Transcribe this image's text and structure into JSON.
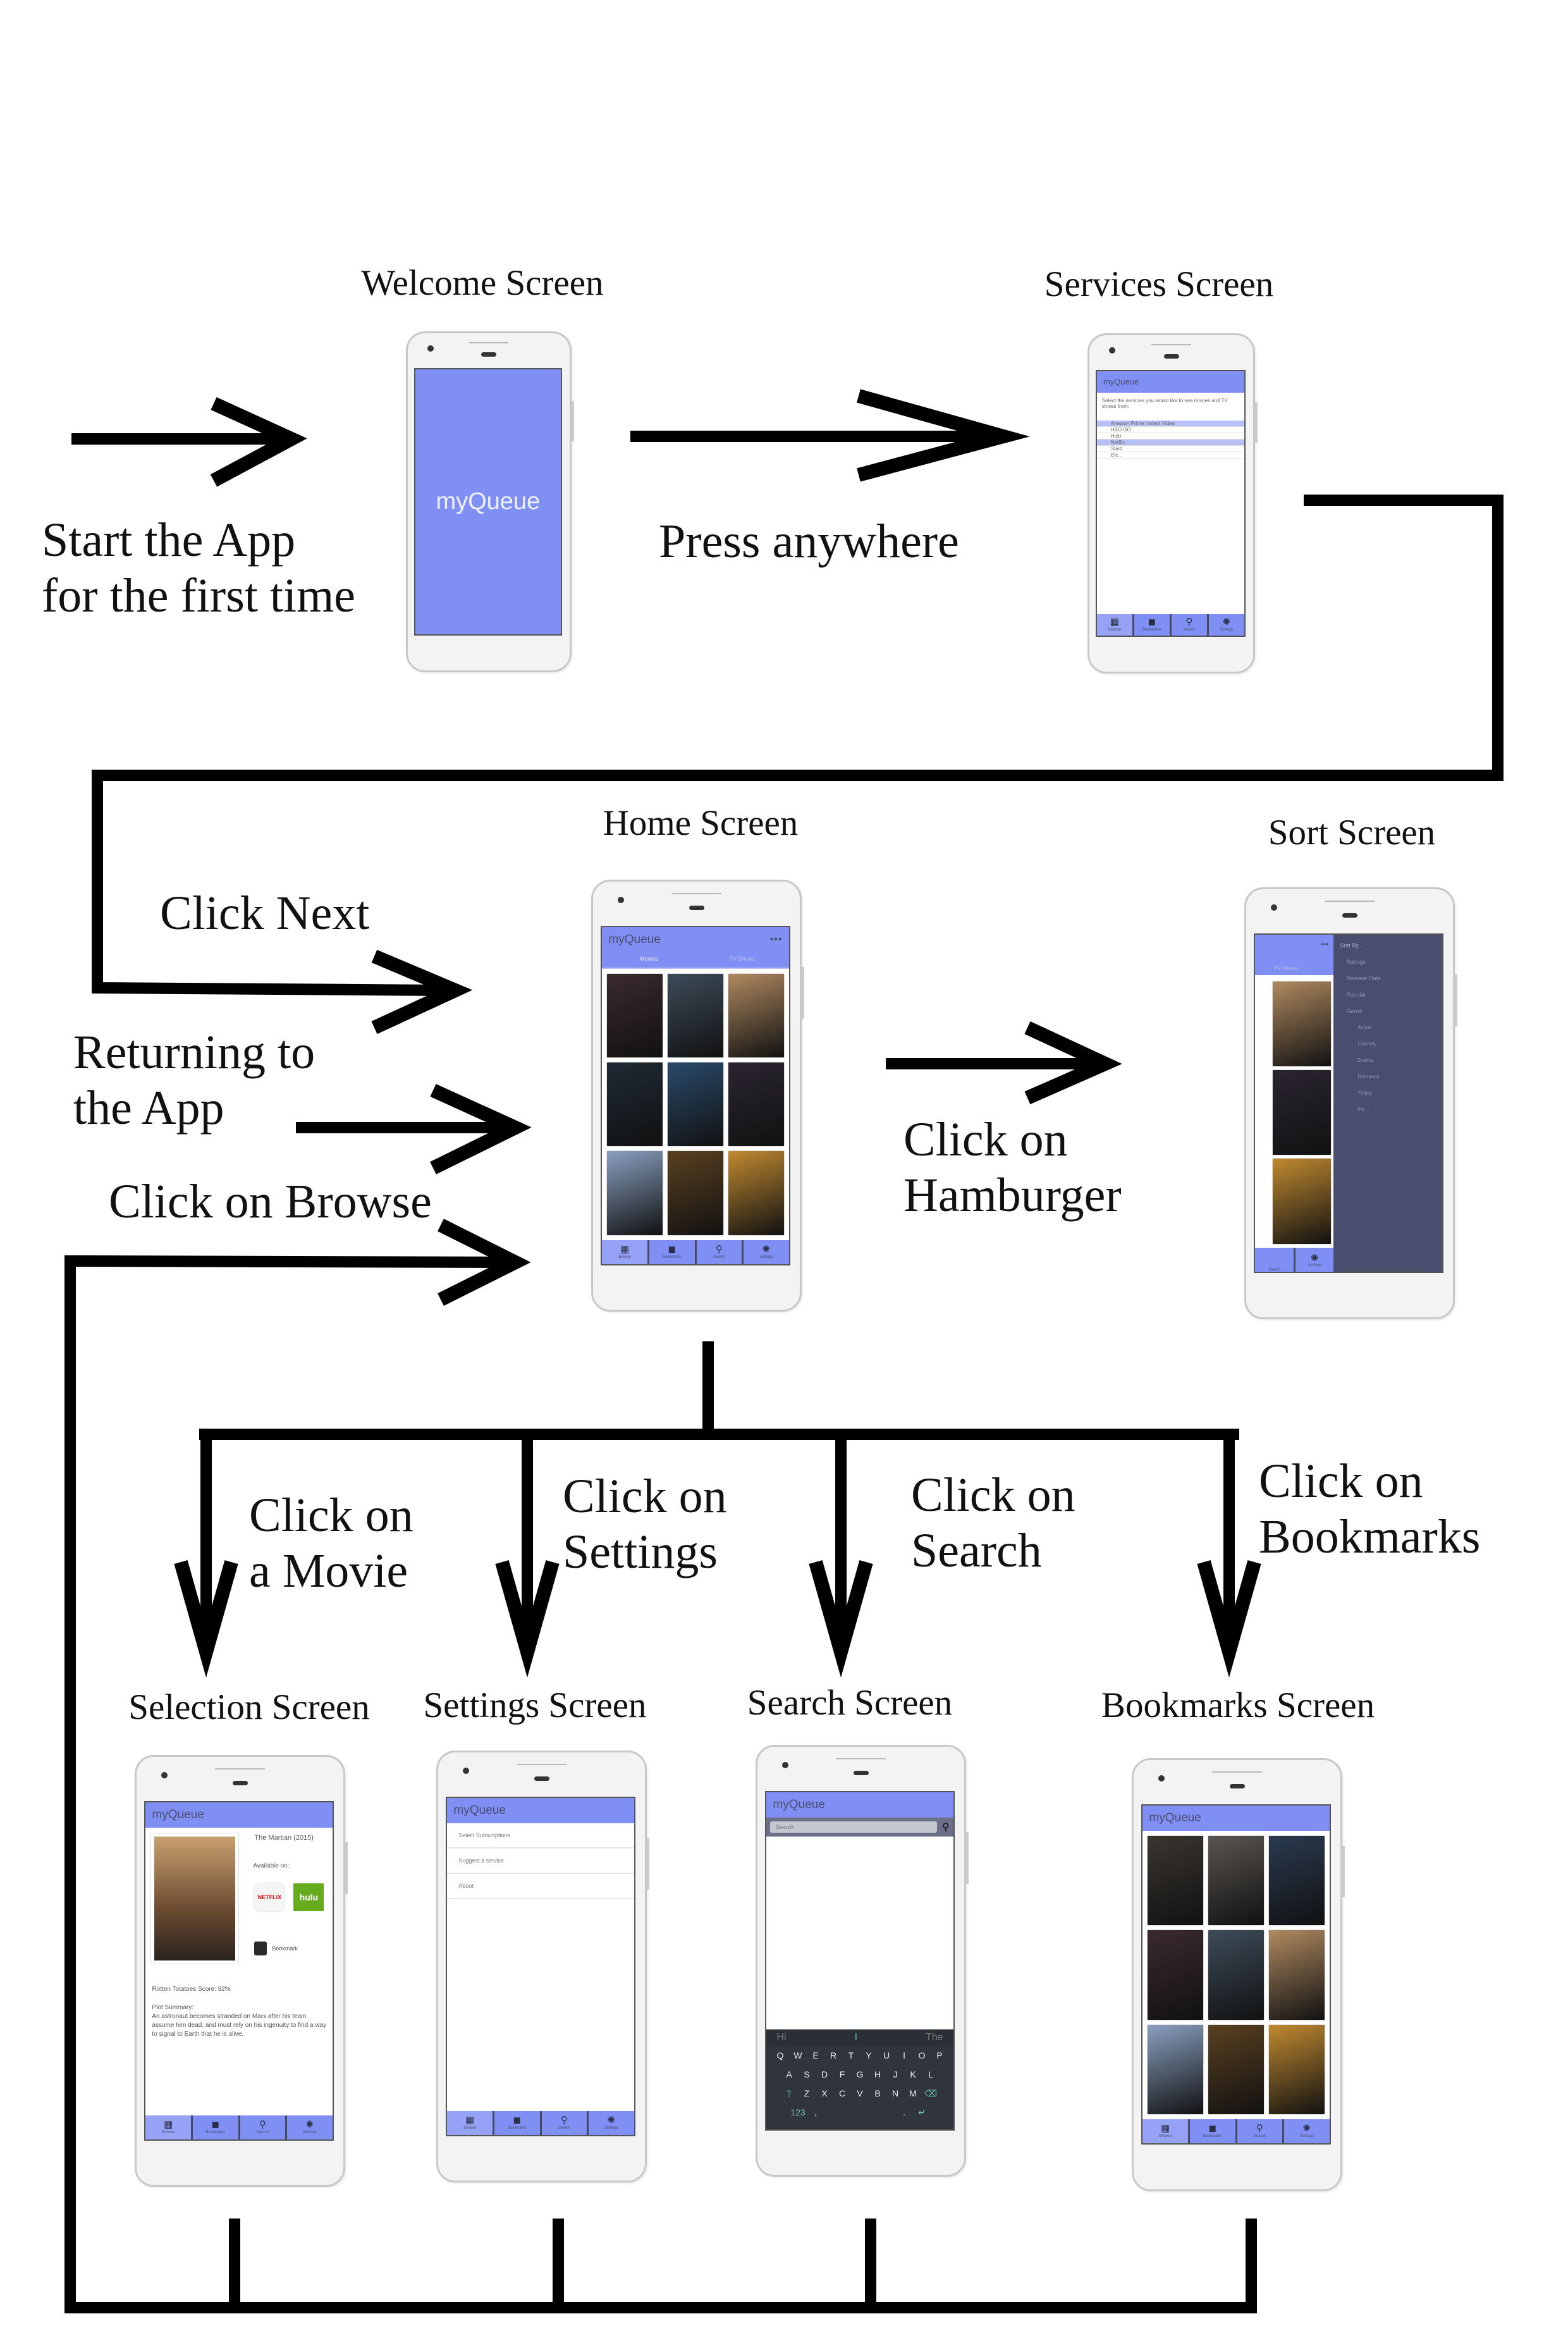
{
  "labels": {
    "start": [
      "Start the App",
      "for the first time"
    ],
    "press_anywhere": "Press anywhere",
    "click_next": "Click Next",
    "returning": [
      "Returning to",
      "the App"
    ],
    "click_browse": "Click on Browse",
    "click_hamburger": [
      "Click on",
      "Hamburger"
    ],
    "click_movie": [
      "Click on",
      "a Movie"
    ],
    "click_settings": [
      "Click on",
      "Settings"
    ],
    "click_search": [
      "Click on",
      "Search"
    ],
    "click_bookmarks": [
      "Click on",
      "Bookmarks"
    ]
  },
  "screen_titles": {
    "welcome": "Welcome Screen",
    "services": "Services Screen",
    "home": "Home Screen",
    "sort": "Sort Screen",
    "selection": "Selection Screen",
    "settings": "Settings Screen",
    "search": "Search Screen",
    "bookmarks": "Bookmarks Screen"
  },
  "app": {
    "name": "myQueue",
    "menu_dots": "•••",
    "accent": "#7f8ff4",
    "dark": "#4a4e6e",
    "highlight": "#b7c0f7"
  },
  "nav": [
    {
      "label": "Browse",
      "icon": "grid-icon",
      "glyph": "▦"
    },
    {
      "label": "Bookmarks",
      "icon": "bookmark-icon",
      "glyph": "◼"
    },
    {
      "label": "Search",
      "icon": "search-icon",
      "glyph": "⚲"
    },
    {
      "label": "Settings",
      "icon": "settings-icon",
      "glyph": "✺"
    }
  ],
  "services": {
    "prompt": "Select the services you would like to see movies and TV shows from:",
    "items": [
      {
        "label": "Amazon Prime Instant Video",
        "selected": true
      },
      {
        "label": "HBO GO",
        "selected": false
      },
      {
        "label": "Hulu",
        "selected": false
      },
      {
        "label": "Netflix",
        "selected": true
      },
      {
        "label": "Starz",
        "selected": false
      },
      {
        "label": "Etc...",
        "selected": false
      }
    ]
  },
  "home": {
    "tabs": [
      "Movies",
      "TV Shows"
    ],
    "poster_colors": [
      "#3a2a30",
      "#3d4c5a",
      "#b08a60",
      "#1e2a35",
      "#2a4a6a",
      "#2b2530",
      "#8aa0c0",
      "#5a4020",
      "#c08a30"
    ]
  },
  "sort": {
    "tab": "TV Shows",
    "heading": "Sort By...",
    "options": [
      "Ratings",
      "Release Date",
      "Popular",
      "Genre"
    ],
    "genres": [
      "Action",
      "Comedy",
      "Drama",
      "Romance",
      "Thiller",
      "Etc..."
    ],
    "poster_colors": [
      "#b08a60",
      "#2b2530",
      "#c08a30"
    ]
  },
  "selection": {
    "title": "The Martian (2015)",
    "available_on": "Available on:",
    "services": [
      {
        "label": "NETFLIX",
        "bg": "#f5f5f5",
        "fg": "#e50914"
      },
      {
        "label": "hulu",
        "bg": "#66aa1e",
        "fg": "#ffffff"
      }
    ],
    "bookmark": "Bookmark",
    "score": "Rotten Totatoes Score: 92%",
    "plot_heading": "Plot Summary:",
    "plot": "An astronaut becomes stranded on Mars after his team assume him dead, and must rely on his ingenuity to find a way to signal to Earth that he is alive.",
    "poster_color": "#a07a55"
  },
  "settings": {
    "items": [
      "Select Subscriptions",
      "Suggest a service",
      "About"
    ]
  },
  "search": {
    "placeholder": "Search",
    "suggestions": [
      "Hi",
      "I",
      "The"
    ],
    "rows": [
      [
        "Q",
        "W",
        "E",
        "R",
        "T",
        "Y",
        "U",
        "I",
        "O",
        "P"
      ],
      [
        "A",
        "S",
        "D",
        "F",
        "G",
        "H",
        "J",
        "K",
        "L"
      ],
      [
        "⇧",
        "Z",
        "X",
        "C",
        "V",
        "B",
        "N",
        "M",
        "⌫"
      ],
      [
        "123",
        ",",
        "",
        "",
        "",
        "",
        ".",
        "↵"
      ]
    ]
  },
  "bookmarks": {
    "poster_colors": [
      "#3a3530",
      "#5a5550",
      "#2a3a50",
      "#3a2a30",
      "#3d4c5a",
      "#b08a60",
      "#8aa0c0",
      "#5a4020",
      "#c08a30"
    ]
  }
}
